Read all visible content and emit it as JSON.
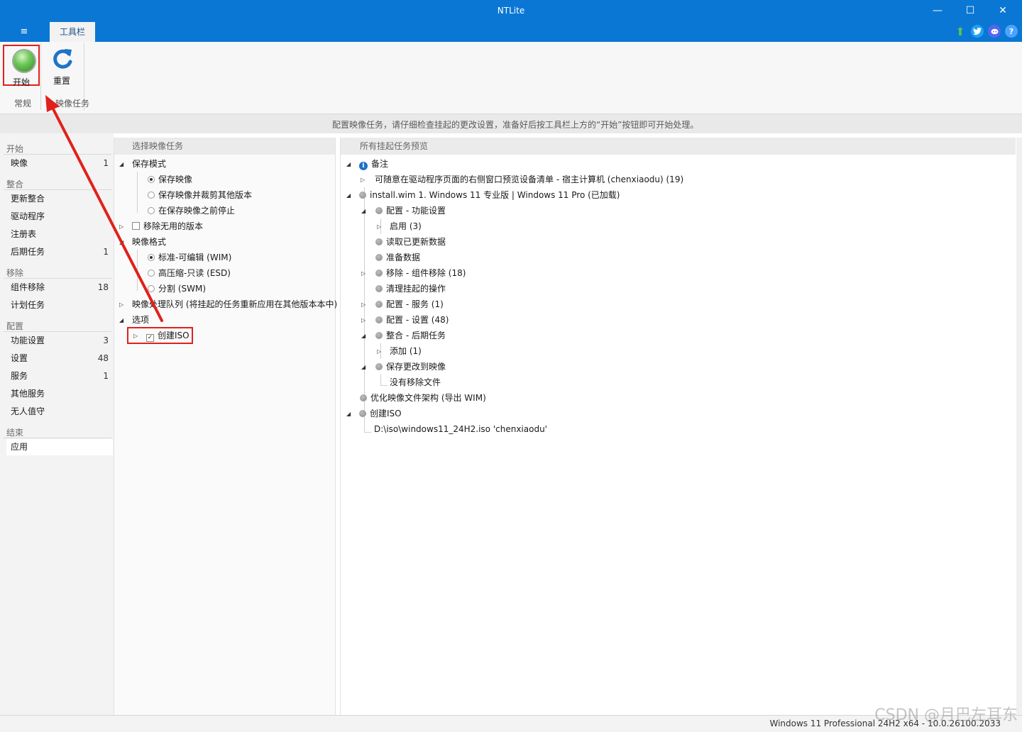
{
  "window": {
    "title": "NTLite",
    "minimize": "—",
    "maximize": "☐",
    "close": "✕"
  },
  "ribbon": {
    "menu_icon": "≡",
    "tab_label": "工具栏",
    "start_label": "开始",
    "reset_label": "重置",
    "group_normal": "常规",
    "group_task": "映像任务",
    "icons": [
      "update-arrow-icon",
      "twitter-icon",
      "discord-icon",
      "help-icon"
    ],
    "help_glyph": "?"
  },
  "info_text": "配置映像任务，请仔细检查挂起的更改设置，准备好后按工具栏上方的“开始”按钮即可开始处理。",
  "leftnav": {
    "cat_start": "开始",
    "item_image": "映像",
    "item_image_count": "1",
    "cat_integrate": "整合",
    "item_updates": "更新整合",
    "item_drivers": "驱动程序",
    "item_registry": "注册表",
    "item_posttasks": "后期任务",
    "item_posttasks_count": "1",
    "cat_remove": "移除",
    "item_components": "组件移除",
    "item_components_count": "18",
    "item_scheduled": "计划任务",
    "cat_configure": "配置",
    "item_features": "功能设置",
    "item_features_count": "3",
    "item_settings": "设置",
    "item_settings_count": "48",
    "item_services": "服务",
    "item_services_count": "1",
    "item_otherservices": "其他服务",
    "item_unattended": "无人值守",
    "cat_finish": "结束",
    "item_apply": "应用"
  },
  "middle": {
    "header": "选择映像任务",
    "save_mode": "保存模式",
    "save_image": "保存映像",
    "save_trim": "保存映像并裁剪其他版本",
    "stop_before": "在保存映像之前停止",
    "remove_unused": "移除无用的版本",
    "image_format": "映像格式",
    "fmt_wim": "标准-可编辑 (WIM)",
    "fmt_esd": "高压缩-只读 (ESD)",
    "fmt_swm": "分割 (SWM)",
    "queue": "映像处理队列 (将挂起的任务重新应用在其他版本本中)",
    "options": "选项",
    "create_iso": "创建ISO"
  },
  "right": {
    "header": "所有挂起任务预览",
    "notes": "备注",
    "notes_child": "可随意在驱动程序页面的右侧窗口预览设备清单 - 宿主计算机 (chenxiaodu) (19)",
    "install_wim": "install.wim 1. Windows 11 专业版  |  Windows 11 Pro  (已加载)",
    "cfg_features": "配置 - 功能设置",
    "enable": "启用 (3)",
    "read_updates": "读取已更新数据",
    "prepare_data": "准备数据",
    "remove_components": "移除 - 组件移除 (18)",
    "cleanup": "清理挂起的操作",
    "cfg_services": "配置 - 服务 (1)",
    "cfg_settings": "配置 - 设置 (48)",
    "integrate_post": "整合 - 后期任务",
    "add": "添加 (1)",
    "save_changes": "保存更改到映像",
    "no_removed": "没有移除文件",
    "optimize": "优化映像文件架构 (导出 WIM)",
    "create_iso": "创建ISO",
    "iso_path": "D:\\iso\\windows11_24H2.iso 'chenxiaodu'"
  },
  "status": "Windows 11 Professional 24H2 x64 - 10.0.26100.2033",
  "watermark": "CSDN @月巴左耳东",
  "colors": {
    "titlebar": "#0a77d4",
    "highlight_box": "#e0211b"
  }
}
